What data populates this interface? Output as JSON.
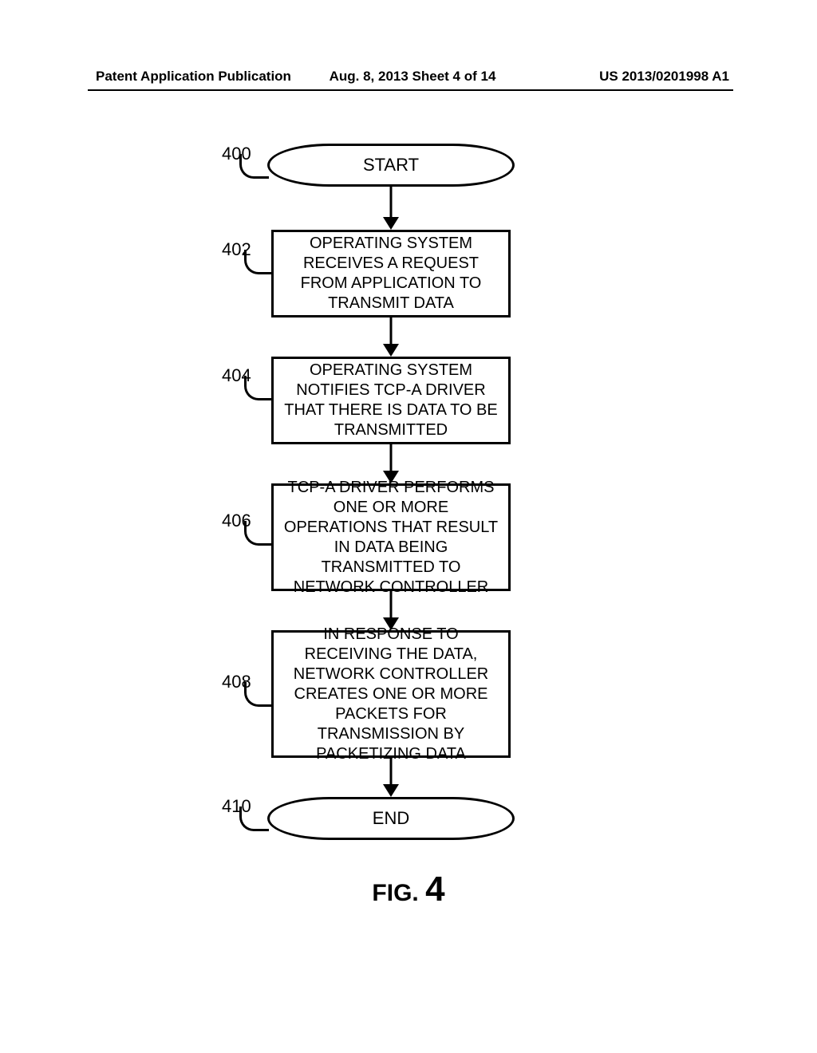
{
  "header": {
    "left": "Patent Application Publication",
    "center": "Aug. 8, 2013  Sheet 4 of 14",
    "right": "US 2013/0201998 A1"
  },
  "flow": {
    "start": {
      "label": "START",
      "ref": "400"
    },
    "step1": {
      "label": "OPERATING SYSTEM RECEIVES A REQUEST FROM APPLICATION TO TRANSMIT DATA",
      "ref": "402"
    },
    "step2": {
      "label": "OPERATING SYSTEM NOTIFIES TCP-A DRIVER THAT THERE IS DATA TO BE TRANSMITTED",
      "ref": "404"
    },
    "step3": {
      "label": "TCP-A DRIVER PERFORMS ONE OR MORE OPERATIONS THAT RESULT IN DATA BEING TRANSMITTED TO NETWORK CONTROLLER",
      "ref": "406"
    },
    "step4": {
      "label": "IN RESPONSE TO RECEIVING THE DATA, NETWORK CONTROLLER CREATES ONE OR MORE PACKETS FOR TRANSMISSION BY PACKETIZING DATA",
      "ref": "408"
    },
    "end": {
      "label": "END",
      "ref": "410"
    }
  },
  "figure": {
    "prefix": "FIG. ",
    "num": "4"
  }
}
